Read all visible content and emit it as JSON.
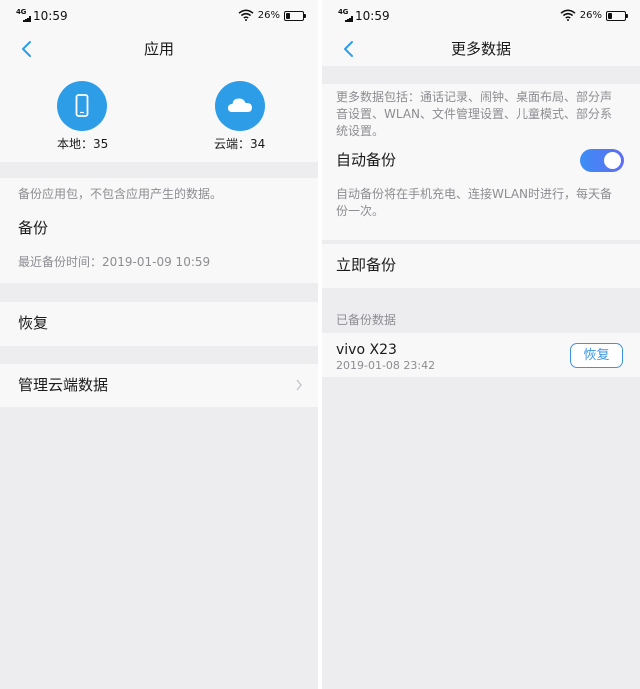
{
  "colors": {
    "accent": "#2d9de8",
    "toggle_on_start": "#3c8ef5",
    "toggle_on_end": "#5f6df2",
    "secondary_text": "#8d8d92",
    "background": "#ededf0"
  },
  "left": {
    "status_bar": {
      "network": "4G",
      "time": "10:59",
      "battery_percent": "26%",
      "battery_level": 0.26
    },
    "title": "应用",
    "local": {
      "icon": "phone-icon",
      "label": "本地：35"
    },
    "cloud": {
      "icon": "cloud-icon",
      "label": "云端：34"
    },
    "backup_description": "备份应用包，不包含应用产生的数据。",
    "backup_label": "备份",
    "last_backup": "最近备份时间：2019-01-09 10:59",
    "restore_label": "恢复",
    "manage_cloud_label": "管理云端数据"
  },
  "right": {
    "status_bar": {
      "network": "4G",
      "time": "10:59",
      "battery_percent": "26%",
      "battery_level": 0.26
    },
    "title": "更多数据",
    "description_lines": [
      "更多数据包括：通话记录、闹钟、桌面布局、部分声",
      "音设置、WLAN、文件管理设置、儿童模式、部分系",
      "统设置。"
    ],
    "auto_backup_label": "自动备份",
    "auto_backup_enabled": true,
    "auto_backup_description_lines": [
      "自动备份将在手机充电、连接WLAN时进行，每天备",
      "份一次。"
    ],
    "backup_now_label": "立即备份",
    "backed_up_header": "已备份数据",
    "backup_item": {
      "device": "vivo X23",
      "date": "2019-01-08 23:42",
      "restore_button": "恢复"
    }
  }
}
